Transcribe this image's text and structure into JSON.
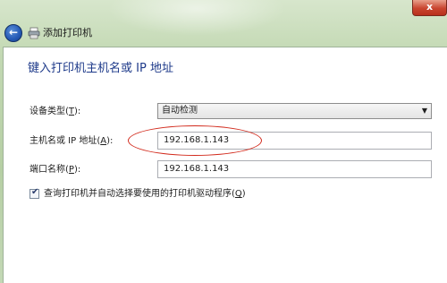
{
  "window": {
    "title": "添加打印机",
    "close_glyph": "x",
    "back_glyph": "←"
  },
  "heading": "键入打印机主机名或 IP 地址",
  "device_type": {
    "label_prefix": "设备类型(",
    "label_key": "T",
    "label_suffix": "):",
    "value": "自动检测"
  },
  "hostname": {
    "label_prefix": "主机名或 IP 地址(",
    "label_key": "A",
    "label_suffix": "):",
    "value": "192.168.1.143"
  },
  "port": {
    "label_prefix": "端口名称(",
    "label_key": "P",
    "label_suffix": "):",
    "value": "192.168.1.143"
  },
  "query_option": {
    "label_prefix": "查询打印机并自动选择要使用的打印机驱动程序(",
    "label_key": "Q",
    "label_suffix": ")",
    "checked": true
  },
  "colors": {
    "heading": "#1e3a8a",
    "annotation": "#d22a1c"
  },
  "icons": [
    "back-arrow-icon",
    "printer-icon",
    "close-icon",
    "chevron-down-icon",
    "checkmark-icon"
  ]
}
